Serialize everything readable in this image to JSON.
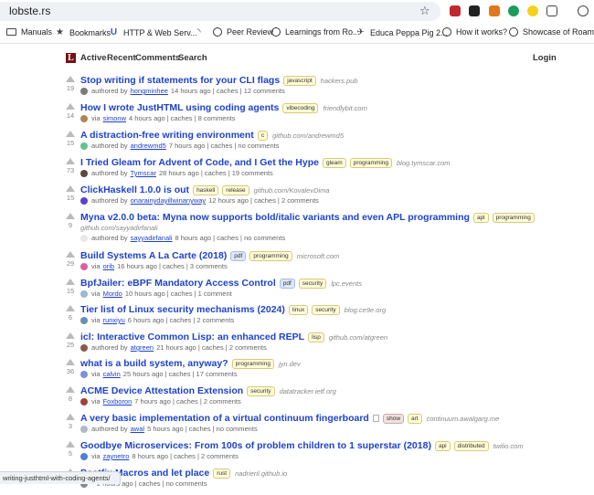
{
  "browser": {
    "url": "lobste.rs",
    "status_url": "writing-justhtml-with-coding-agents/",
    "bookmarks": [
      {
        "label": "Manuals",
        "icon": "folder-icon"
      },
      {
        "label": "Bookmarks",
        "icon": "star-icon"
      },
      {
        "label": "HTTP & Web Serv...",
        "icon": "library-icon"
      },
      {
        "label": "",
        "icon": "rss-icon"
      },
      {
        "label": "Peer Review",
        "icon": "globe-icon"
      },
      {
        "label": "Learnings from Ro...",
        "icon": "globe-icon"
      },
      {
        "label": "Educa Peppa Pig 2...",
        "icon": "airplane-icon"
      },
      {
        "label": "How it works?",
        "icon": "globe-icon"
      },
      {
        "label": "Showcase of Roam",
        "icon": "globe-icon"
      }
    ]
  },
  "site": {
    "logo": "L",
    "nav": [
      "Active",
      "Recent",
      "Comments",
      "Search"
    ],
    "login": "Login"
  },
  "stories": [
    {
      "title": "Stop writing if statements for your CLI flags",
      "tags": [
        {
          "t": "javascript",
          "k": "lang"
        }
      ],
      "domain": "hackers.pub",
      "score": "19",
      "by_label": "authored by",
      "user": "hongminhee",
      "meta": "14 hours ago | caches | 12 comments",
      "avatar": "#7a7a7a"
    },
    {
      "title": "How I wrote JustHTML using coding agents",
      "tags": [
        {
          "t": "vibecoding",
          "k": "lang"
        }
      ],
      "domain": "friendlybit.com",
      "score": "14",
      "by_label": "via",
      "user": "simonw",
      "meta": "4 hours ago | caches | 8 comments",
      "avatar": "#b3835a"
    },
    {
      "title": "A distraction-free writing environment",
      "tags": [
        {
          "t": "c",
          "k": "lang"
        }
      ],
      "domain": "github.com/andrewmd5",
      "score": "15",
      "by_label": "authored by",
      "user": "andrewmd5",
      "meta": "7 hours ago | caches | no comments",
      "avatar": "#62c28f"
    },
    {
      "title": "I Tried Gleam for Advent of Code, and I Get the Hype",
      "tags": [
        {
          "t": "gleam",
          "k": "lang"
        },
        {
          "t": "programming",
          "k": "lang"
        }
      ],
      "domain": "blog.tymscar.com",
      "score": "73",
      "by_label": "authored by",
      "user": "Tymscar",
      "meta": "28 hours ago | caches | 19 comments",
      "avatar": "#5a4b3c"
    },
    {
      "title": "ClickHaskell 1.0.0 is out",
      "tags": [
        {
          "t": "haskell",
          "k": "lang"
        },
        {
          "t": "release",
          "k": "lang"
        }
      ],
      "domain": "github.com/KovalevDima",
      "score": "15",
      "by_label": "authored by",
      "user": "onarainydayillwinanyway",
      "meta": "12 hours ago | caches | 2 comments",
      "avatar": "#5b3fd6"
    },
    {
      "title": "Myna v2.0.0 beta: Myna now supports bold/italic variants and even APL programming",
      "tags": [
        {
          "t": "apl",
          "k": "lang"
        },
        {
          "t": "programming",
          "k": "lang"
        }
      ],
      "domain": "github.com/sayyadirfanali",
      "score": "9",
      "by_label": "authored by",
      "user": "sayyadirfanali",
      "meta": "8 hours ago | caches | no comments",
      "avatar": "#e8e8e8"
    },
    {
      "title": "Build Systems A La Carte (2018)",
      "tags": [
        {
          "t": "pdf",
          "k": "media"
        },
        {
          "t": "programming",
          "k": "lang"
        }
      ],
      "domain": "microsoft.com",
      "score": "29",
      "by_label": "via",
      "user": "orib",
      "meta": "16 hours ago | caches | 3 comments",
      "avatar": "#e05fa0"
    },
    {
      "title": "BpfJailer: eBPF Mandatory Access Control",
      "tags": [
        {
          "t": "pdf",
          "k": "media"
        },
        {
          "t": "security",
          "k": "lang"
        }
      ],
      "domain": "lpc.events",
      "score": "15",
      "by_label": "via",
      "user": "Mordo",
      "meta": "10 hours ago | caches | 1 comment",
      "avatar": "#9ab8d0"
    },
    {
      "title": "Tier list of Linux security mechanisms (2024)",
      "tags": [
        {
          "t": "linux",
          "k": "lang"
        },
        {
          "t": "security",
          "k": "lang"
        }
      ],
      "domain": "blog.ce9e.org",
      "score": "6",
      "by_label": "via",
      "user": "runxiyu",
      "meta": "6 hours ago | caches | 2 comments",
      "avatar": "#6b8fb0"
    },
    {
      "title": "icl: Interactive Common Lisp: an enhanced REPL",
      "tags": [
        {
          "t": "lisp",
          "k": "lang"
        }
      ],
      "domain": "github.com/atgreen",
      "score": "25",
      "by_label": "authored by",
      "user": "atgreen",
      "meta": "21 hours ago | caches | 2 comments",
      "avatar": "#8a5a4a"
    },
    {
      "title": "what is a build system, anyway?",
      "tags": [
        {
          "t": "programming",
          "k": "lang"
        }
      ],
      "domain": "jyn.dev",
      "score": "36",
      "by_label": "via",
      "user": "calvin",
      "meta": "25 hours ago | caches | 17 comments",
      "avatar": "#7b8fe0"
    },
    {
      "title": "ACME Device Attestation Extension",
      "tags": [
        {
          "t": "security",
          "k": "lang"
        }
      ],
      "domain": "datatracker.ietf.org",
      "score": "8",
      "by_label": "via",
      "user": "Foxboron",
      "meta": "7 hours ago | caches | 2 comments",
      "avatar": "#a0423a"
    },
    {
      "title": "A very basic implementation of a virtual continuum fingerboard",
      "tags": [
        {
          "t": "show",
          "k": "meta"
        },
        {
          "t": "art",
          "k": "lang"
        }
      ],
      "domain": "continuum.awalgarg.me",
      "score": "3",
      "by_label": "authored by",
      "user": "awal",
      "meta": "5 hours ago | caches | no comments",
      "avatar": "#b0b8c8",
      "textpost": true
    },
    {
      "title": "Goodbye Microservices: From 100s of problem children to 1 superstar (2018)",
      "tags": [
        {
          "t": "api",
          "k": "lang"
        },
        {
          "t": "distributed",
          "k": "lang"
        }
      ],
      "domain": "twilio.com",
      "score": "5",
      "by_label": "via",
      "user": "zaynetro",
      "meta": "8 hours ago | caches | 2 comments",
      "avatar": "#4f7fdc"
    },
    {
      "title": "Postfix Macros and let place",
      "tags": [
        {
          "t": "rust",
          "k": "lang"
        }
      ],
      "domain": "nadrieril.github.io",
      "score": "",
      "by_label": "",
      "user": "",
      "meta": "2 hours ago | caches | no comments",
      "avatar": "#888888"
    }
  ]
}
